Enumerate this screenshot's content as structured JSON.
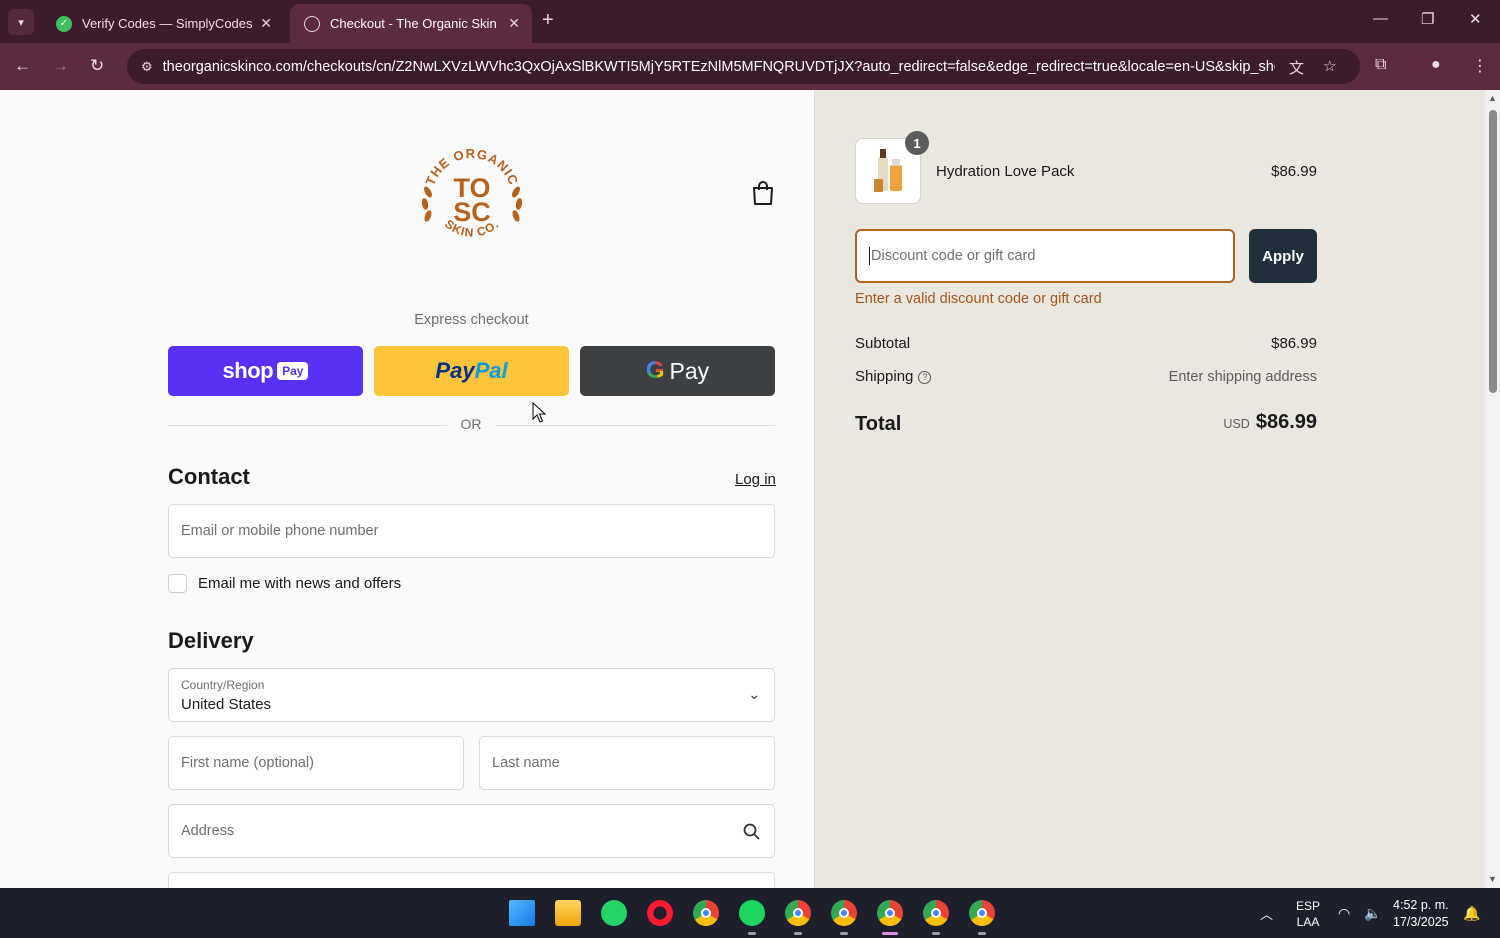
{
  "browser": {
    "tabs": [
      {
        "title": "Verify Codes — SimplyCodes",
        "active": false
      },
      {
        "title": "Checkout - The Organic Skin Co",
        "active": true
      }
    ],
    "url": "theorganicskinco.com/checkouts/cn/Z2NwLXVzLWVhc3QxOjAxSlBKWTI5MjY5RTEzNlM5MFNQRUVDTjJX?auto_redirect=false&edge_redirect=true&locale=en-US&skip_sho..."
  },
  "store": {
    "logo_text_top": "THE ORGANIC",
    "logo_monogram_top": "TO",
    "logo_monogram_bottom": "SC",
    "logo_text_bottom": "SKIN CO."
  },
  "express": {
    "label": "Express checkout",
    "shoppay_label": "shop",
    "shoppay_badge": "Pay",
    "paypal_part1": "Pay",
    "paypal_part2": "Pal",
    "gpay_g": "G",
    "gpay_label": "Pay",
    "or_label": "OR"
  },
  "contact": {
    "heading": "Contact",
    "login_link": "Log in",
    "email_placeholder": "Email or mobile phone number",
    "newsletter_label": "Email me with news and offers"
  },
  "delivery": {
    "heading": "Delivery",
    "country_label": "Country/Region",
    "country_value": "United States",
    "first_name_placeholder": "First name (optional)",
    "last_name_placeholder": "Last name",
    "address_placeholder": "Address"
  },
  "summary": {
    "product_name": "Hydration Love Pack",
    "product_qty": "1",
    "product_price": "$86.99",
    "discount_placeholder": "Discount code or gift card",
    "apply_label": "Apply",
    "discount_error": "Enter a valid discount code or gift card",
    "subtotal_label": "Subtotal",
    "subtotal_value": "$86.99",
    "shipping_label": "Shipping",
    "shipping_value": "Enter shipping address",
    "total_label": "Total",
    "total_currency": "USD",
    "total_value": "$86.99"
  },
  "taskbar": {
    "lang_top": "ESP",
    "lang_bottom": "LAA",
    "time": "4:52 p. m.",
    "date": "17/3/2025"
  },
  "colors": {
    "browser_frame": "#3c1b2b",
    "browser_toolbar": "#5c2a41",
    "shoppay": "#5a31f4",
    "paypal": "#ffc439",
    "gpay": "#3c4043",
    "apply_button": "#1f2f3b",
    "error_text": "#a5561a",
    "logo_brand": "#b8611d"
  }
}
